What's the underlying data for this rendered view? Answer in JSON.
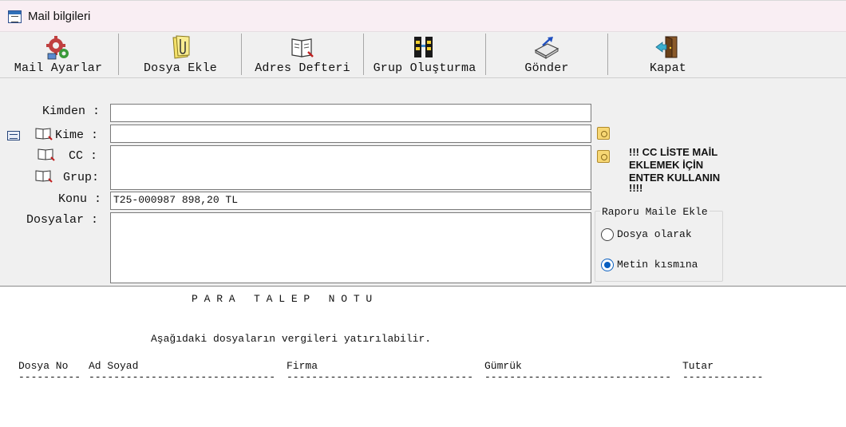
{
  "window": {
    "title": "Mail bilgileri"
  },
  "toolbar": {
    "items": [
      {
        "label": "Mail Ayarlar",
        "icon": "mail-settings-icon"
      },
      {
        "label": "Dosya Ekle",
        "icon": "attach-file-icon"
      },
      {
        "label": "Adres Defteri",
        "icon": "address-book-icon"
      },
      {
        "label": "Grup Oluşturma",
        "icon": "create-group-icon"
      },
      {
        "label": "Gönder",
        "icon": "send-icon"
      },
      {
        "label": "Kapat",
        "icon": "exit-door-icon"
      }
    ]
  },
  "form": {
    "from_label": "Kimden :",
    "from_value": "",
    "to_label": "Kime :",
    "to_value": "",
    "cc_label": "CC :",
    "cc_value": "",
    "group_label": "Grup:",
    "subject_label": "Konu :",
    "subject_value": "T25-000987 898,20 TL",
    "files_label": "Dosyalar :",
    "files_value": ""
  },
  "notice": {
    "line1": "!!! CC LİSTE MAİL",
    "line2": "EKLEMEK İÇİN",
    "line3": "ENTER KULLANIN",
    "line4": "!!!!"
  },
  "report_attach": {
    "title": "Raporu Maile Ekle",
    "options": [
      {
        "label": "Dosya olarak",
        "checked": false
      },
      {
        "label": "Metin kısmına",
        "checked": true
      }
    ]
  },
  "report": {
    "heading": "P A R A   T A L E P   N O T U",
    "sentence": "Aşağıdaki dosyaların vergileri yatırılabilir.",
    "columns": [
      "Dosya No",
      "Ad Soyad",
      "Firma",
      "Gümrük",
      "Tutar"
    ],
    "dashes": [
      "----------",
      "------------------------------",
      "------------------------------",
      "------------------------------",
      "-------------"
    ]
  },
  "colors": {
    "title_bg": "#f9eef3",
    "accent": "#0a5fc0",
    "button_yellow": "#f7d774"
  }
}
